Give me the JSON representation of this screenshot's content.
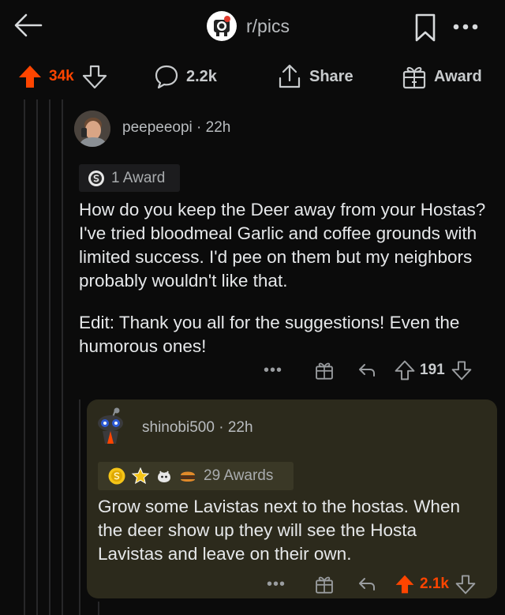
{
  "header": {
    "subreddit": "r/pics"
  },
  "post_actions": {
    "upvotes": "34k",
    "comments": "2.2k",
    "share_label": "Share",
    "award_label": "Award"
  },
  "comments": [
    {
      "author": "peepeeopi",
      "age": "22h",
      "awards": "1 Award",
      "body": [
        "How do you keep the Deer away from your Hostas? I've tried bloodmeal Garlic and coffee grounds with limited success. I'd pee on them but my neighbors probably wouldn't like that.",
        "Edit: Thank you all for the suggestions! Even the humorous ones!"
      ],
      "score": "191",
      "upvoted": false
    },
    {
      "author": "shinobi500",
      "age": "22h",
      "awards": "29 Awards",
      "body": [
        "Grow some Lavistas next to the hostas. When the deer show up they will see the Hosta Lavistas and leave on their own."
      ],
      "score": "2.1k",
      "upvoted": true
    }
  ],
  "separator": "·",
  "more_glyph": "•••",
  "colors": {
    "background": "#0b0b0b",
    "upvote_orange": "#ff4500",
    "highlight_card": "#2c2a1c",
    "text": "#e6e8ea",
    "muted": "#b9bcbf"
  },
  "icons": {
    "back": "arrow-left-icon",
    "bookmark": "bookmark-icon",
    "more": "more-horizontal-icon",
    "upvote": "upvote-arrow-icon",
    "downvote": "downvote-arrow-icon",
    "comment": "comment-bubble-icon",
    "share": "share-icon",
    "award": "gift-icon",
    "reply": "reply-icon"
  }
}
